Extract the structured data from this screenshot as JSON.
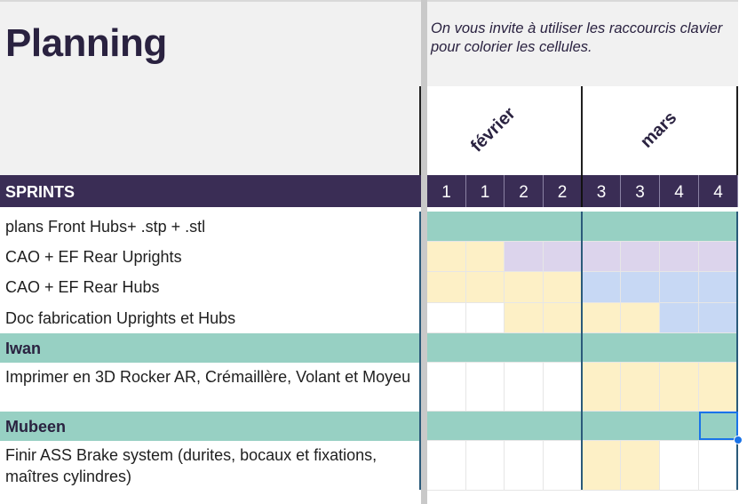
{
  "title": "Planning",
  "hint": "On vous invite à utiliser les raccourcis clavier pour colorier les cellules.",
  "months": [
    "février",
    "mars"
  ],
  "sprint_header": "SPRINTS",
  "sprint_numbers": [
    "1",
    "1",
    "2",
    "2",
    "3",
    "3",
    "4",
    "4"
  ],
  "rows": [
    {
      "label": "plans Front Hubs+ .stp + .stl",
      "section": false,
      "cells": [
        "teal",
        "teal",
        "teal",
        "teal",
        "teal",
        "teal",
        "teal",
        "teal"
      ]
    },
    {
      "label": "CAO + EF Rear Uprights",
      "section": false,
      "cells": [
        "yellow",
        "yellow",
        "purple",
        "purple",
        "purple",
        "purple",
        "purple",
        "purple"
      ]
    },
    {
      "label": "CAO + EF Rear Hubs",
      "section": false,
      "cells": [
        "yellow",
        "yellow",
        "yellow",
        "yellow",
        "blue",
        "blue",
        "blue",
        "blue"
      ]
    },
    {
      "label": "Doc fabrication Uprights et Hubs",
      "section": false,
      "cells": [
        "white",
        "white",
        "yellow",
        "yellow",
        "yellow",
        "yellow",
        "blue",
        "blue"
      ]
    },
    {
      "label": "Iwan",
      "section": true,
      "cells": [
        "teal",
        "teal",
        "teal",
        "teal",
        "teal",
        "teal",
        "teal",
        "teal"
      ]
    },
    {
      "label": "Imprimer en 3D Rocker AR, Crémaillère, Volant et Moyeu",
      "section": false,
      "cells": [
        "white",
        "white",
        "white",
        "white",
        "yellow",
        "yellow",
        "yellow",
        "yellow"
      ]
    },
    {
      "label": "Mubeen",
      "section": true,
      "cells": [
        "teal",
        "teal",
        "teal",
        "teal",
        "teal",
        "teal",
        "teal",
        "teal"
      ]
    },
    {
      "label": "Finir ASS Brake system (durites, bocaux et fixations, maîtres cylindres)",
      "section": false,
      "cells": [
        "white",
        "white",
        "white",
        "white",
        "yellow",
        "yellow",
        "white",
        "white"
      ]
    }
  ],
  "colors": {
    "teal": "#97d0c3",
    "yellow": "#fdf0c6",
    "purple": "#dcd4ec",
    "blue": "#c7d8f4",
    "header_purple": "#3a2d55",
    "selection": "#1a73e8"
  }
}
